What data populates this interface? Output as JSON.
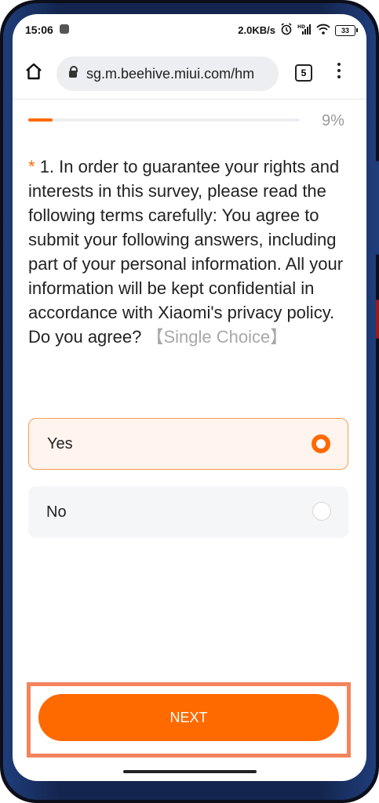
{
  "status_bar": {
    "time": "15:06",
    "network_speed": "2.0KB/s",
    "battery_level": "33",
    "icons": [
      "app-notification-icon",
      "alarm-icon",
      "hd-icon",
      "signal-icon",
      "wifi-icon",
      "battery-icon"
    ]
  },
  "browser": {
    "url": "sg.m.beehive.miui.com/hm",
    "tab_count": "5",
    "icons": [
      "home-icon",
      "lock-icon",
      "menu-icon"
    ]
  },
  "survey": {
    "progress_percent": 9,
    "progress_text": "9%",
    "required_mark": "*",
    "question_text": "1. In order to guarantee your rights and interests in this survey, please read the following terms carefully: You agree to submit your following answers, including part of your personal information. All your information will be kept confidential in accordance with Xiaomi's privacy policy. Do you agree?",
    "question_type": "【Single Choice】",
    "options": [
      {
        "label": "Yes",
        "selected": true
      },
      {
        "label": "No",
        "selected": false
      }
    ],
    "next_label": "NEXT"
  },
  "colors": {
    "accent": "#ff6a00",
    "selected_bg": "#fff5ee",
    "option_bg": "#f5f6f8",
    "highlight_border": "#f4845c"
  }
}
